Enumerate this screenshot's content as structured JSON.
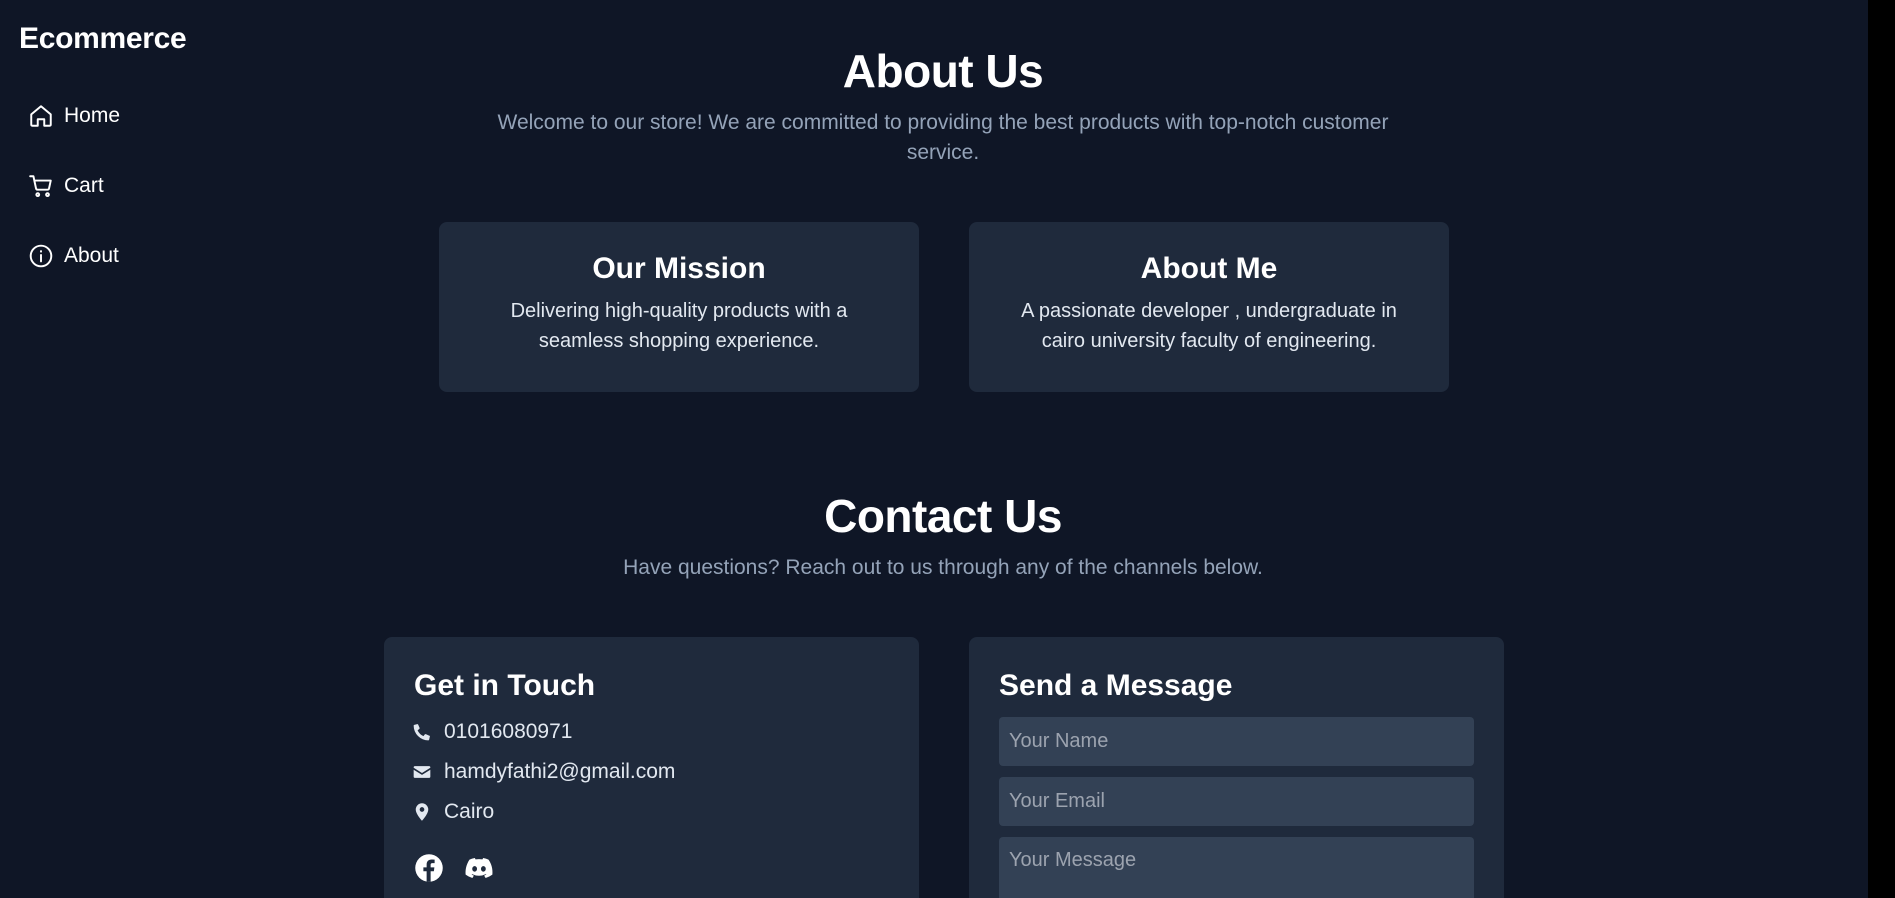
{
  "sidebar": {
    "brand": "Ecommerce",
    "items": [
      {
        "label": "Home",
        "icon": "home-icon"
      },
      {
        "label": "Cart",
        "icon": "cart-icon"
      },
      {
        "label": "About",
        "icon": "info-icon"
      }
    ]
  },
  "about": {
    "title": "About Us",
    "intro": "Welcome to our store! We are committed to providing the best products with top-notch customer service.",
    "cards": [
      {
        "title": "Our Mission",
        "text": "Delivering high-quality products with a seamless shopping experience."
      },
      {
        "title": "About Me",
        "text": "A passionate developer , undergraduate in cairo university faculty of engineering."
      }
    ]
  },
  "contact": {
    "title": "Contact Us",
    "intro": "Have questions? Reach out to us through any of the channels below.",
    "get_in_touch": {
      "title": "Get in Touch",
      "phone": "01016080971",
      "email": "hamdyfathi2@gmail.com",
      "location": "Cairo",
      "social_icons": [
        "facebook-icon",
        "discord-icon"
      ]
    },
    "form": {
      "title": "Send a Message",
      "name_placeholder": "Your Name",
      "email_placeholder": "Your Email",
      "message_placeholder": "Your Message"
    }
  },
  "colors": {
    "background": "#0f1626",
    "card": "#1f2a3c",
    "input": "#334155",
    "muted_text": "#94a3b8"
  }
}
